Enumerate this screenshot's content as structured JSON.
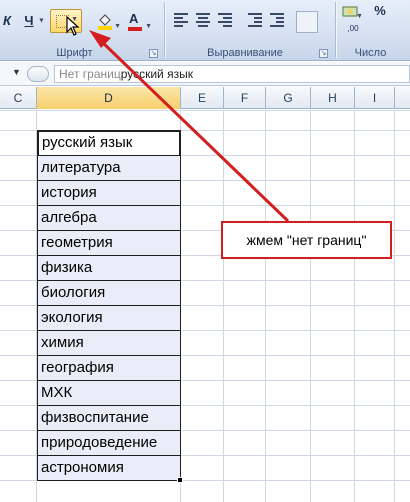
{
  "ribbon": {
    "font_group": {
      "label": "Шрифт",
      "italic_label": "К",
      "underline_label": "Ч",
      "font_color_label": "А"
    },
    "align_group": {
      "label": "Выравнивание"
    },
    "number_group": {
      "label": "Число",
      "percent_label": "%"
    },
    "accent_color": "#d21e1e",
    "highlight_color": "#ffd66a"
  },
  "formula_bar": {
    "placeholder_prefix": "Нет границ",
    "value": "русский язык"
  },
  "columns": [
    "C",
    "D",
    "E",
    "F",
    "G",
    "H",
    "I"
  ],
  "selected_column": "D",
  "cells": [
    "русский язык",
    "литература",
    "история",
    "алгебра",
    "геометрия",
    "физика",
    "биология",
    "экология",
    "химия",
    "география",
    "МХК",
    "физвоспитание",
    "природоведение",
    "астрономия"
  ],
  "annotation": {
    "text": "жмем \"нет границ\""
  }
}
